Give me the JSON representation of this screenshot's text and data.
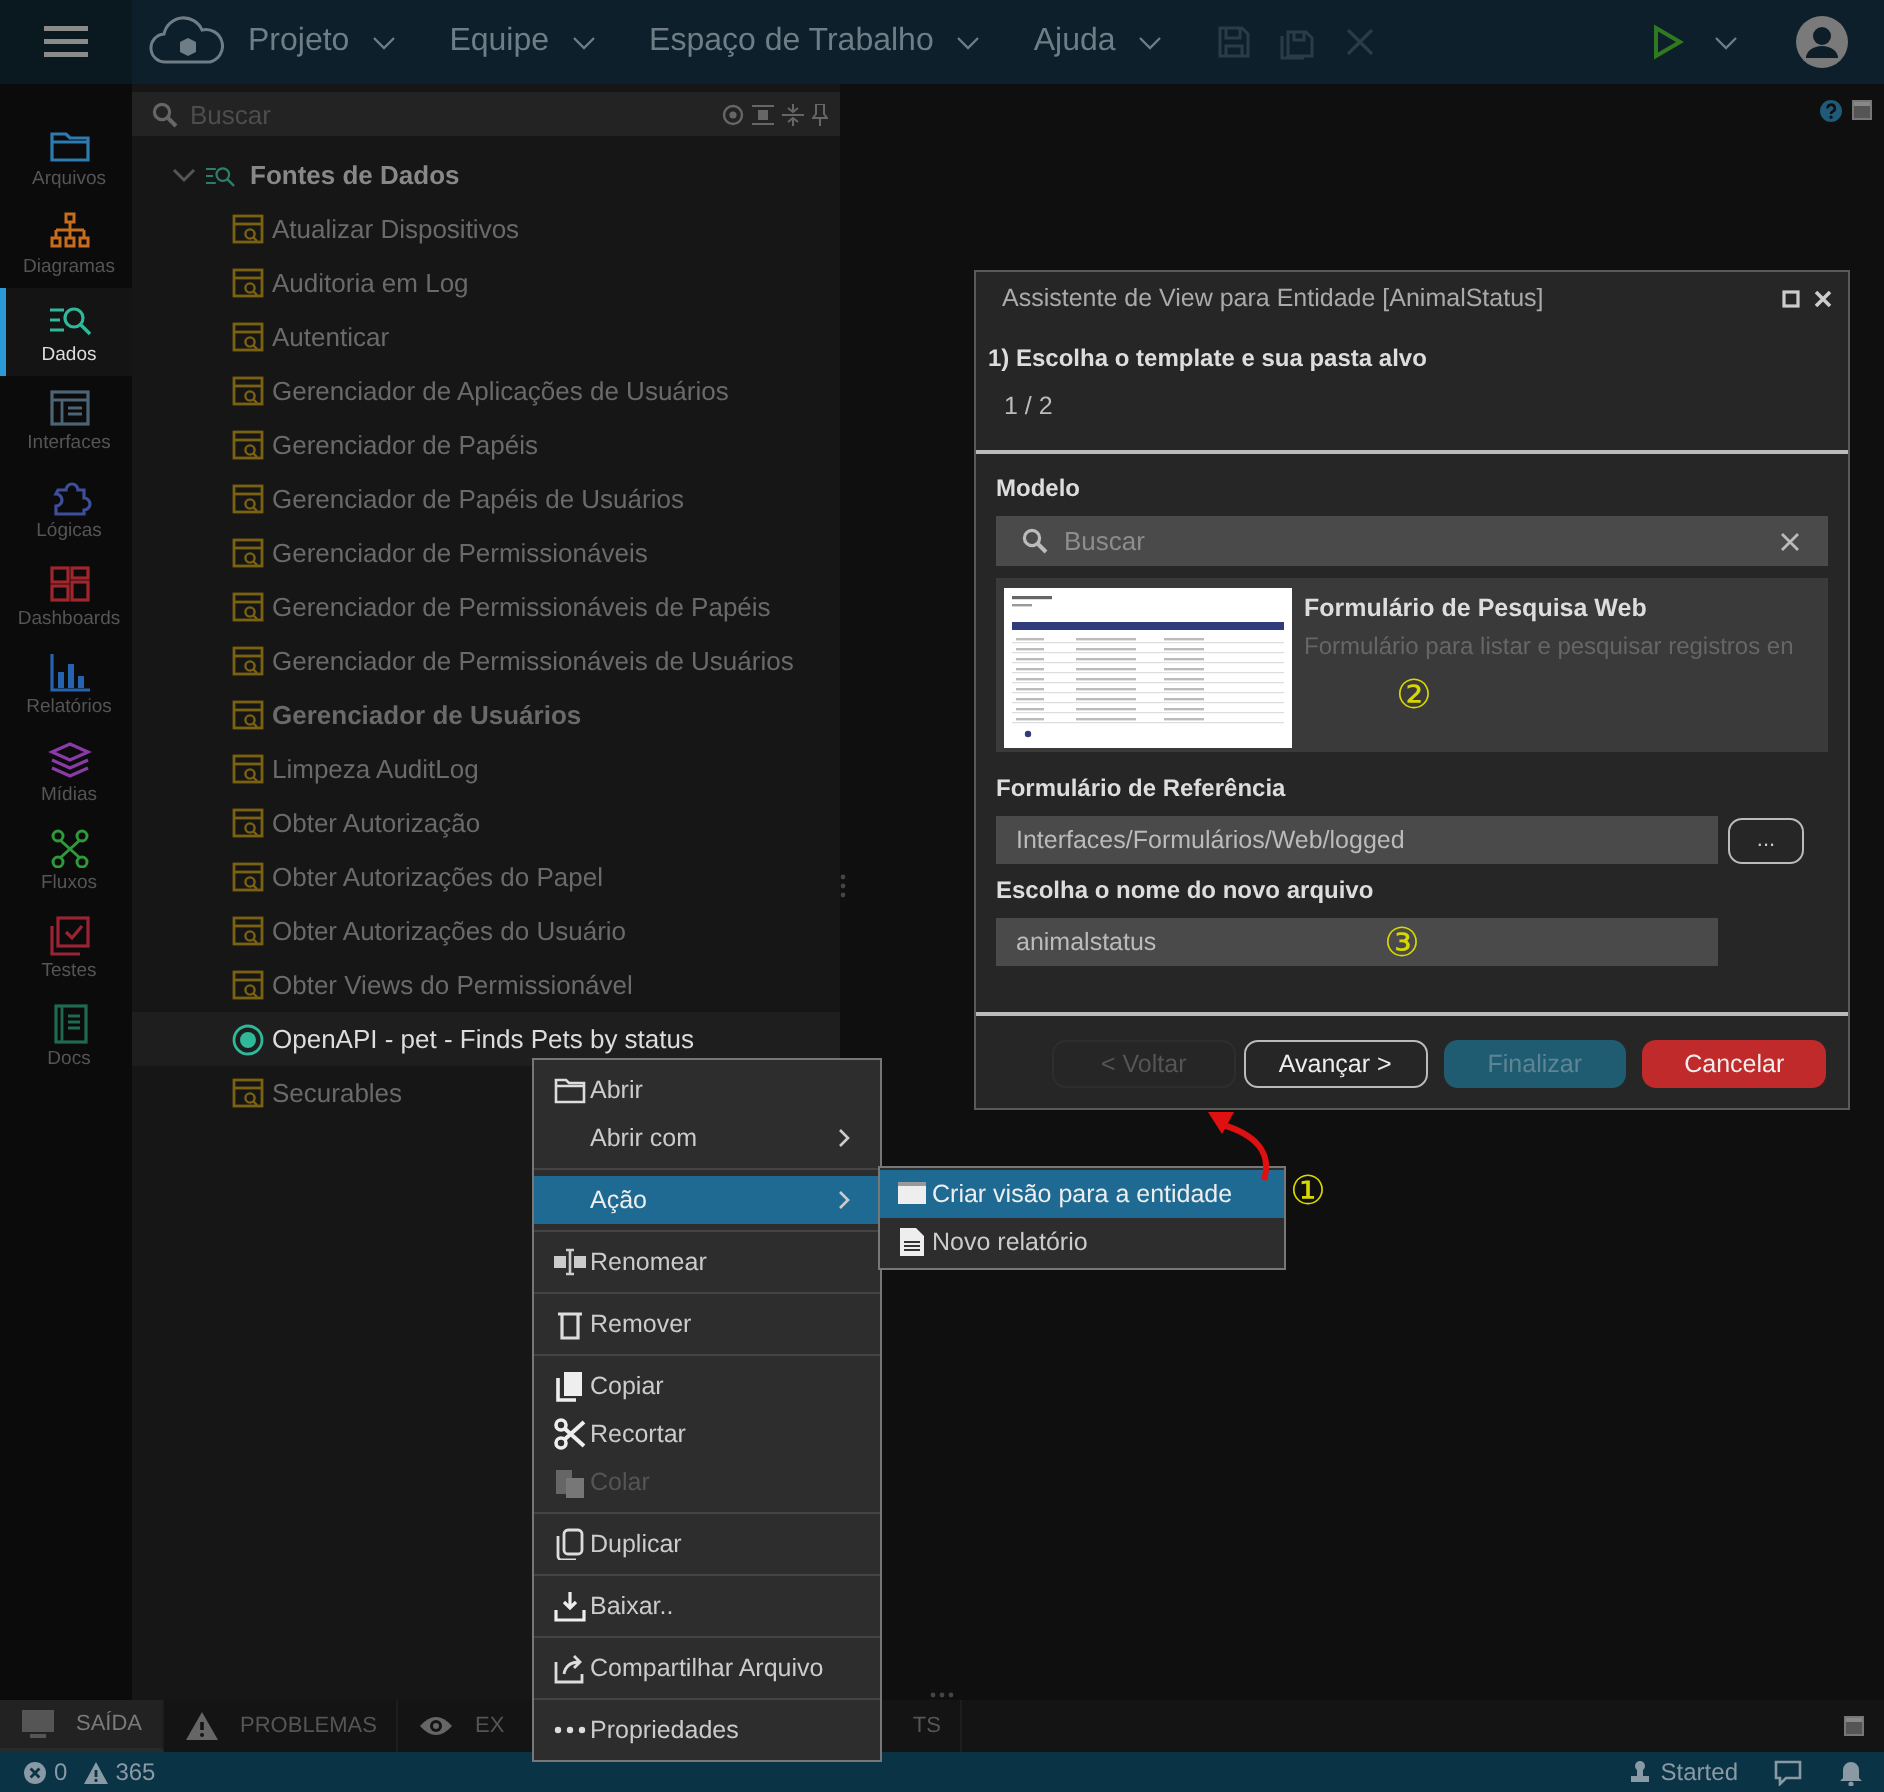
{
  "top_bar": {
    "menus": [
      {
        "label": "Projeto"
      },
      {
        "label": "Equipe"
      },
      {
        "label": "Espaço de Trabalho"
      },
      {
        "label": "Ajuda"
      }
    ]
  },
  "rail": {
    "items": [
      {
        "label": "Arquivos",
        "color": "#2d7bb0",
        "selected": false
      },
      {
        "label": "Diagramas",
        "color": "#c86c1e",
        "selected": false
      },
      {
        "label": "Dados",
        "color": "#2fb89a",
        "selected": true
      },
      {
        "label": "Interfaces",
        "color": "#4d6474",
        "selected": false
      },
      {
        "label": "Lógicas",
        "color": "#3d4f9a",
        "selected": false
      },
      {
        "label": "Dashboards",
        "color": "#a0262c",
        "selected": false
      },
      {
        "label": "Relatórios",
        "color": "#2563b0",
        "selected": false
      },
      {
        "label": "Mídias",
        "color": "#8a3ba8",
        "selected": false
      },
      {
        "label": "Fluxos",
        "color": "#2f9a3a",
        "selected": false
      },
      {
        "label": "Testes",
        "color": "#9a2434",
        "selected": false
      },
      {
        "label": "Docs",
        "color": "#1f6a50",
        "selected": false
      }
    ]
  },
  "explorer": {
    "search": {
      "placeholder": "Buscar"
    },
    "tree": [
      {
        "label": "Fontes de Dados",
        "expanded": true,
        "children": [
          {
            "label": "Atualizar Dispositivos",
            "kind": "view",
            "bold": false,
            "selected": false
          },
          {
            "label": "Auditoria em Log",
            "kind": "view",
            "bold": false,
            "selected": false
          },
          {
            "label": "Autenticar",
            "kind": "view",
            "bold": false,
            "selected": false
          },
          {
            "label": "Gerenciador de Aplicações de Usuários",
            "kind": "view",
            "bold": false,
            "selected": false
          },
          {
            "label": "Gerenciador de Papéis",
            "kind": "view",
            "bold": false,
            "selected": false
          },
          {
            "label": "Gerenciador de Papéis de Usuários",
            "kind": "view",
            "bold": false,
            "selected": false
          },
          {
            "label": "Gerenciador de Permissionáveis",
            "kind": "view",
            "bold": false,
            "selected": false
          },
          {
            "label": "Gerenciador de Permissionáveis de Papéis",
            "kind": "view",
            "bold": false,
            "selected": false
          },
          {
            "label": "Gerenciador de Permissionáveis de Usuários",
            "kind": "view",
            "bold": false,
            "selected": false
          },
          {
            "label": "Gerenciador de Usuários",
            "kind": "view",
            "bold": true,
            "selected": false
          },
          {
            "label": "Limpeza AuditLog",
            "kind": "view",
            "bold": false,
            "selected": false
          },
          {
            "label": "Obter Autorização",
            "kind": "view",
            "bold": false,
            "selected": false
          },
          {
            "label": "Obter Autorizações do Papel",
            "kind": "view",
            "bold": false,
            "selected": false
          },
          {
            "label": "Obter Autorizações do Usuário",
            "kind": "view",
            "bold": false,
            "selected": false
          },
          {
            "label": "Obter Views do Permissionável",
            "kind": "view",
            "bold": false,
            "selected": false
          },
          {
            "label": "OpenAPI - pet - Finds Pets by status",
            "kind": "api",
            "bold": false,
            "selected": true
          },
          {
            "label": "Securables",
            "kind": "view",
            "bold": false,
            "selected": false
          }
        ]
      }
    ]
  },
  "dialog": {
    "title": "Assistente de View para Entidade [AnimalStatus]",
    "step_title": "1) Escolha o template e sua pasta alvo",
    "step_counter": "1 / 2",
    "model_label": "Modelo",
    "search": {
      "placeholder": "Buscar"
    },
    "template": {
      "title": "Formulário de Pesquisa Web",
      "description": "Formulário para listar e pesquisar registros en"
    },
    "reference_label": "Formulário de Referência",
    "reference_value": "Interfaces/Formulários/Web/logged",
    "browse_button": "...",
    "name_label": "Escolha o nome do novo arquivo",
    "name_value": "animalstatus",
    "buttons": [
      {
        "label": "< Voltar",
        "kind": "back",
        "disabled": true
      },
      {
        "label": "Avançar >",
        "kind": "outline",
        "disabled": false
      },
      {
        "label": "Finalizar",
        "kind": "primary",
        "disabled": true
      },
      {
        "label": "Cancelar",
        "kind": "danger",
        "disabled": false
      }
    ]
  },
  "context_menu": {
    "groups": [
      {
        "items": [
          {
            "label": "Abrir",
            "submenu": false,
            "selected": false,
            "disabled": false
          },
          {
            "label": "Abrir com",
            "submenu": true,
            "selected": false,
            "disabled": false
          }
        ]
      },
      {
        "items": [
          {
            "label": "Ação",
            "submenu": true,
            "selected": true,
            "disabled": false
          }
        ]
      },
      {
        "items": [
          {
            "label": "Renomear",
            "submenu": false,
            "selected": false,
            "disabled": false
          }
        ]
      },
      {
        "items": [
          {
            "label": "Remover",
            "submenu": false,
            "selected": false,
            "disabled": false
          }
        ]
      },
      {
        "items": [
          {
            "label": "Copiar",
            "submenu": false,
            "selected": false,
            "disabled": false
          },
          {
            "label": "Recortar",
            "submenu": false,
            "selected": false,
            "disabled": false
          },
          {
            "label": "Colar",
            "submenu": false,
            "selected": false,
            "disabled": true
          }
        ]
      },
      {
        "items": [
          {
            "label": "Duplicar",
            "submenu": false,
            "selected": false,
            "disabled": false
          }
        ]
      },
      {
        "items": [
          {
            "label": "Baixar..",
            "submenu": false,
            "selected": false,
            "disabled": false
          }
        ]
      },
      {
        "items": [
          {
            "label": "Compartilhar Arquivo",
            "submenu": false,
            "selected": false,
            "disabled": false
          }
        ]
      },
      {
        "items": [
          {
            "label": "Propriedades",
            "submenu": false,
            "selected": false,
            "disabled": false
          }
        ]
      }
    ]
  },
  "submenu": {
    "items": [
      {
        "label": "Criar visão para a entidade",
        "selected": true
      },
      {
        "label": "Novo relatório",
        "selected": false
      }
    ]
  },
  "annotations": [
    {
      "text": "①"
    },
    {
      "text": "②"
    },
    {
      "text": "③"
    }
  ],
  "panel_tabs": [
    {
      "label": "SAÍDA",
      "selected": true
    },
    {
      "label": "PROBLEMAS",
      "selected": false
    },
    {
      "label": "EX",
      "label_end": "TS",
      "selected": false
    }
  ],
  "status_bar": {
    "errors": "0",
    "warnings": "365",
    "state": "Started"
  }
}
